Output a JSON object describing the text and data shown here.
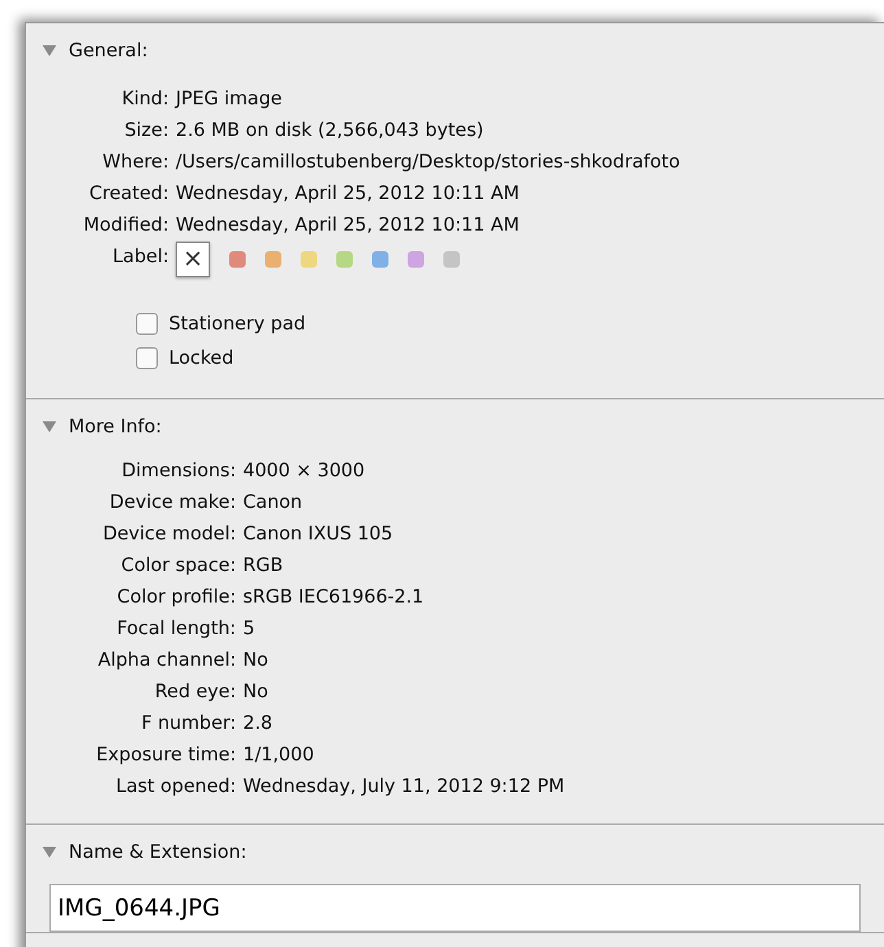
{
  "sections": [
    {
      "kind": "general",
      "title": "General:",
      "expanded": true,
      "rows": [
        {
          "label": "Kind:",
          "value": "JPEG image"
        },
        {
          "label": "Size:",
          "value": "2.6 MB on disk (2,566,043 bytes)"
        },
        {
          "label": "Where:",
          "value": "/Users/camillostubenberg/Desktop/stories-shkodrafoto"
        },
        {
          "label": "Created:",
          "value": "Wednesday, April 25, 2012 10:11 AM"
        },
        {
          "label": "Modified:",
          "value": "Wednesday, April 25, 2012 10:11 AM"
        }
      ],
      "label_row": {
        "label": "Label:",
        "options": [
          {
            "kind": "none",
            "text": "×",
            "selected": true
          },
          {
            "kind": "color",
            "color": "#e08a7e",
            "selected": false
          },
          {
            "kind": "color",
            "color": "#eab070",
            "selected": false
          },
          {
            "kind": "color",
            "color": "#eed77e",
            "selected": false
          },
          {
            "kind": "color",
            "color": "#b6d884",
            "selected": false
          },
          {
            "kind": "color",
            "color": "#7fb1e6",
            "selected": false
          },
          {
            "kind": "color",
            "color": "#cfa4e2",
            "selected": false
          },
          {
            "kind": "color",
            "color": "#c4c4c4",
            "selected": false
          }
        ]
      },
      "checkboxes": [
        {
          "label": "Stationery pad",
          "checked": false
        },
        {
          "label": "Locked",
          "checked": false
        }
      ]
    },
    {
      "kind": "info",
      "title": "More Info:",
      "expanded": true,
      "rows": [
        {
          "label": "Dimensions:",
          "value": "4000 × 3000"
        },
        {
          "label": "Device make:",
          "value": "Canon"
        },
        {
          "label": "Device model:",
          "value": "Canon IXUS 105"
        },
        {
          "label": "Color space:",
          "value": "RGB"
        },
        {
          "label": "Color profile:",
          "value": "sRGB IEC61966-2.1"
        },
        {
          "label": "Focal length:",
          "value": "5"
        },
        {
          "label": "Alpha channel:",
          "value": "No"
        },
        {
          "label": "Red eye:",
          "value": "No"
        },
        {
          "label": "F number:",
          "value": "2.8"
        },
        {
          "label": "Exposure time:",
          "value": "1/1,000"
        },
        {
          "label": "Last opened:",
          "value": "Wednesday, July 11, 2012 9:12 PM"
        }
      ]
    },
    {
      "kind": "name",
      "title": "Name & Extension:",
      "expanded": true,
      "field": {
        "value": "IMG_0644.JPG"
      }
    }
  ]
}
